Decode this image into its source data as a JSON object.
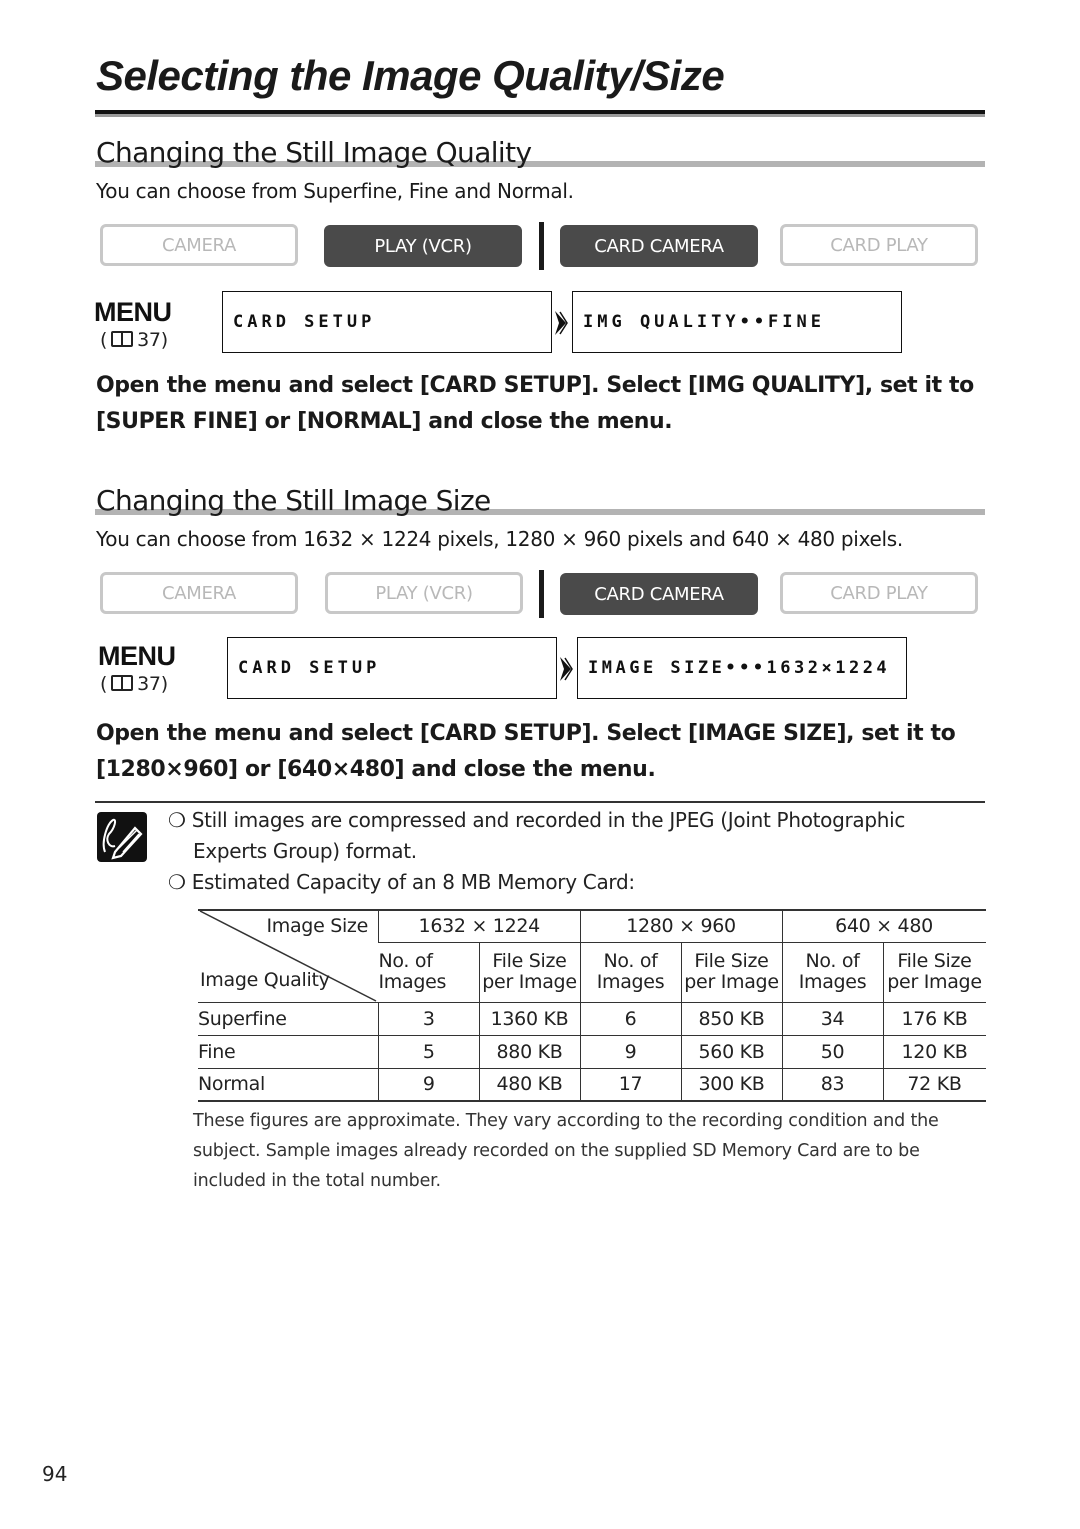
{
  "page": {
    "title": "Selecting the Image Quality/Size",
    "page_number": "94"
  },
  "section_quality": {
    "heading": "Changing the Still Image Quality",
    "intro": "You can choose from Superfine, Fine and Normal.",
    "modes": [
      {
        "label": "CAMERA",
        "active": false
      },
      {
        "label": "PLAY (VCR)",
        "active": true
      },
      {
        "label": "CARD CAMERA",
        "active": true
      },
      {
        "label": "CARD PLAY",
        "active": false
      }
    ],
    "menu_logo": "MENU",
    "menu_ref": "37",
    "lcd_menu": "CARD SETUP",
    "lcd_setting": "IMG QUALITY••FINE",
    "instruction": "Open the menu and select [CARD SETUP]. Select [IMG QUALITY], set it to [SUPER FINE] or [NORMAL] and close the menu."
  },
  "section_size": {
    "heading": "Changing the Still Image Size",
    "intro": "You can choose from 1632 × 1224 pixels, 1280 × 960 pixels and 640 × 480 pixels.",
    "modes": [
      {
        "label": "CAMERA",
        "active": false
      },
      {
        "label": "PLAY (VCR)",
        "active": false
      },
      {
        "label": "CARD CAMERA",
        "active": true
      },
      {
        "label": "CARD PLAY",
        "active": false
      }
    ],
    "menu_logo": "MENU",
    "menu_ref": "37",
    "lcd_menu": "CARD SETUP",
    "lcd_setting": "IMAGE SIZE•••1632×1224",
    "instruction": "Open the menu and select [CARD SETUP]. Select [IMAGE SIZE], set it to [1280×960] or [640×480] and close the menu."
  },
  "notes": {
    "icon": "pencil-note-icon",
    "bullet_glyph": "❍",
    "bullets": [
      {
        "line1": "Still images are compressed and recorded in the JPEG (Joint Photographic",
        "line2": "Experts Group) format."
      },
      {
        "line1": "Estimated Capacity of an 8 MB Memory Card:"
      }
    ]
  },
  "capacity_table": {
    "corner_top": "Image Size",
    "corner_bottom": "Image Quality",
    "sizes": [
      "1632 × 1224",
      "1280 × 960",
      "640 × 480"
    ],
    "sub_headers": {
      "count": [
        "No. of",
        "Images"
      ],
      "file": [
        "File Size",
        "per Image"
      ]
    },
    "rows": [
      {
        "quality": "Superfine",
        "values": [
          "3",
          "1360 KB",
          "6",
          "850 KB",
          "34",
          "176 KB"
        ]
      },
      {
        "quality": "Fine",
        "values": [
          "5",
          "880 KB",
          "9",
          "560 KB",
          "50",
          "120 KB"
        ]
      },
      {
        "quality": "Normal",
        "values": [
          "9",
          "480 KB",
          "17",
          "300 KB",
          "83",
          "72 KB"
        ]
      }
    ],
    "footnote": "These figures are approximate. They vary according to the recording condition and the subject. Sample images already recorded on the supplied SD Memory Card are to be included in the total number."
  }
}
